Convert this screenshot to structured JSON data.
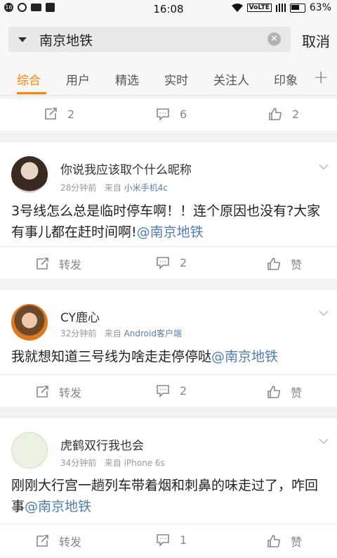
{
  "status_bar": {
    "time": "16:08",
    "network": "VoLTE",
    "battery": "63%",
    "badge": "16"
  },
  "search": {
    "query": "南京地铁",
    "cancel_label": "取消"
  },
  "tabs": [
    {
      "label": "综合",
      "active": true
    },
    {
      "label": "用户"
    },
    {
      "label": "精选"
    },
    {
      "label": "实时"
    },
    {
      "label": "关注人"
    },
    {
      "label": "印象"
    }
  ],
  "colors": {
    "accent": "#ff8200",
    "mention": "#507daf",
    "source": "#5d7ea8"
  },
  "top_actions": {
    "repost": "2",
    "comment": "6",
    "like": "2"
  },
  "posts": [
    {
      "username": "你说我应该取个什么昵称",
      "time": "28分钟前",
      "from_label": "来自",
      "source": "小米手机4c",
      "text": "3号线怎么总是临时停车啊！！连个原因也没有?大家有事儿都在赶时间啊!",
      "mention": "@南京地铁",
      "repost": "转发",
      "comment": "2",
      "like": "赞"
    },
    {
      "username": "CY鹿心",
      "time": "32分钟前",
      "from_label": "来自",
      "source": "Android客户端",
      "text": "我就想知道三号线为啥走走停停哒",
      "mention": "@南京地铁",
      "repost": "转发",
      "comment": "2",
      "like": "赞"
    },
    {
      "username": "虎鹤双行我也会",
      "time": "34分钟前",
      "from_label": "来自",
      "source": "iPhone 6s",
      "text": "刚刚大行宫一趟列车带着烟和刺鼻的味走过了，咋回事",
      "mention": "@南京地铁",
      "repost": "转发",
      "comment": "1",
      "like": "赞"
    }
  ]
}
